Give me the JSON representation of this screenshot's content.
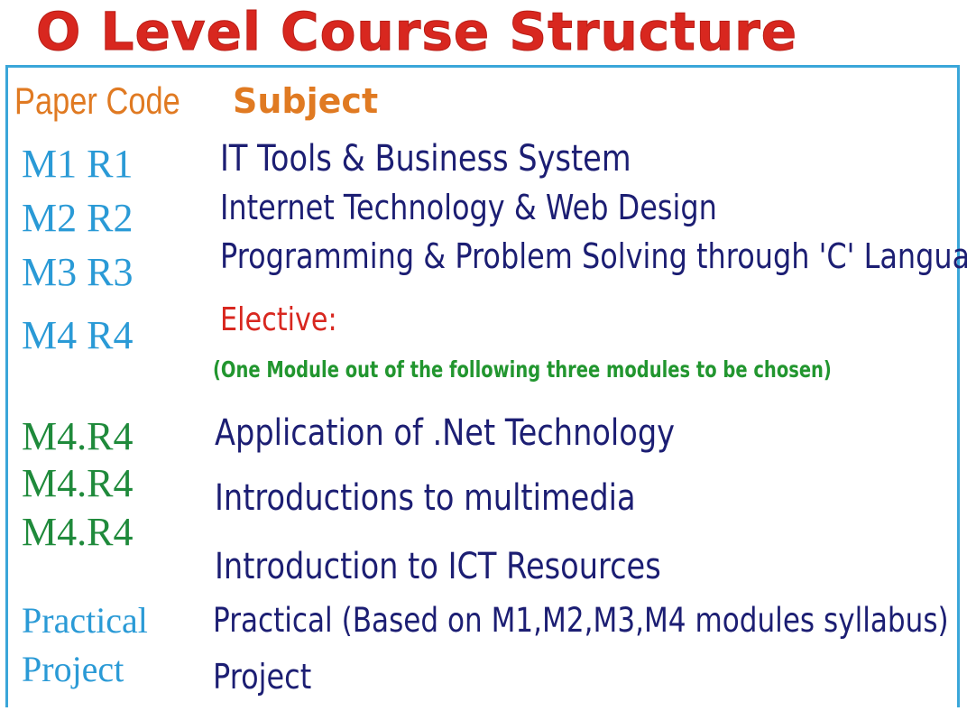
{
  "title": "O Level Course Structure",
  "headers": {
    "paper_code": "Paper Code",
    "subject": "Subject"
  },
  "modules": [
    {
      "code": "M1 R1",
      "subject": "IT Tools & Business System"
    },
    {
      "code": "M2 R2",
      "subject": "Internet Technology & Web Design"
    },
    {
      "code": "M3 R3",
      "subject": "Programming & Problem Solving through 'C' Language"
    },
    {
      "code": "M4 R4",
      "subject": "Elective:"
    }
  ],
  "elective_note": "(One Module out of the following three modules to be chosen)",
  "electives": [
    {
      "code": "M4.R4",
      "subject": "Application of .Net Technology"
    },
    {
      "code": "M4.R4",
      "subject": "Introductions to multimedia"
    },
    {
      "code": "M4.R4",
      "subject": "Introduction to ICT Resources"
    }
  ],
  "practical": {
    "code": "Practical",
    "subject": "Practical (Based on M1,M2,M3,M4  modules syllabus)"
  },
  "project": {
    "code": "Project",
    "subject": "Project"
  },
  "colors": {
    "title": "#d8271f",
    "header": "#e07a22",
    "code_blue": "#2a9ad6",
    "code_green": "#1f8a3b",
    "subject": "#1c1e73",
    "elective": "#d8271f",
    "note": "#22962f",
    "frame": "#3aa6d9"
  }
}
